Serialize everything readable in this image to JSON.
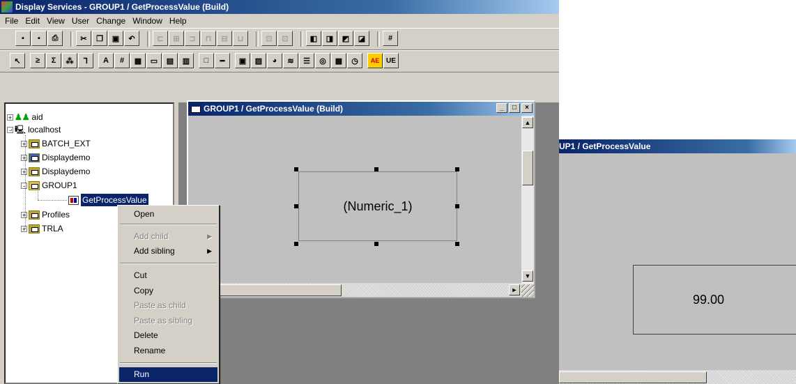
{
  "main_window": {
    "title": "Display Services - GROUP1 / GetProcessValue (Build)"
  },
  "menu": [
    "File",
    "Edit",
    "View",
    "User",
    "Change",
    "Window",
    "Help"
  ],
  "toolbar2_text_buttons": {
    "text": "A",
    "number": "#",
    "ae": "AE",
    "ue": "UE"
  },
  "tree": {
    "items": [
      {
        "label": "aid",
        "expander": "+"
      },
      {
        "label": "localhost",
        "expander": "-"
      },
      {
        "label": "BATCH_EXT",
        "expander": "+"
      },
      {
        "label": "Displaydemo",
        "expander": "+"
      },
      {
        "label": "Displaydemo",
        "expander": "+"
      },
      {
        "label": "GROUP1",
        "expander": "-"
      },
      {
        "label": "GetProcessValue",
        "expander": ""
      },
      {
        "label": "Profiles",
        "expander": "+"
      },
      {
        "label": "TRLA",
        "expander": "+"
      }
    ]
  },
  "child_window": {
    "title": "GROUP1 / GetProcessValue (Build)",
    "element_label": "(Numeric_1)",
    "buttons": {
      "minimize": "_",
      "maximize": "□",
      "close": "×"
    }
  },
  "context_menu": {
    "items": [
      {
        "label": "Open",
        "enabled": true
      },
      {
        "label": "Add child",
        "enabled": false,
        "submenu": true
      },
      {
        "label": "Add sibling",
        "enabled": true,
        "submenu": true
      },
      {
        "label": "Cut",
        "enabled": true
      },
      {
        "label": "Copy",
        "enabled": true
      },
      {
        "label": "Paste as child",
        "enabled": false
      },
      {
        "label": "Paste as sibling",
        "enabled": false
      },
      {
        "label": "Delete",
        "enabled": true
      },
      {
        "label": "Rename",
        "enabled": true
      },
      {
        "label": "Run",
        "enabled": true,
        "highlighted": true
      }
    ]
  },
  "run_window": {
    "title": "UP1 / GetProcessValue",
    "value": "99.00"
  },
  "colors": {
    "titlebar": "#0a246a",
    "face": "#d4d0c8",
    "selection": "#0a246a"
  }
}
